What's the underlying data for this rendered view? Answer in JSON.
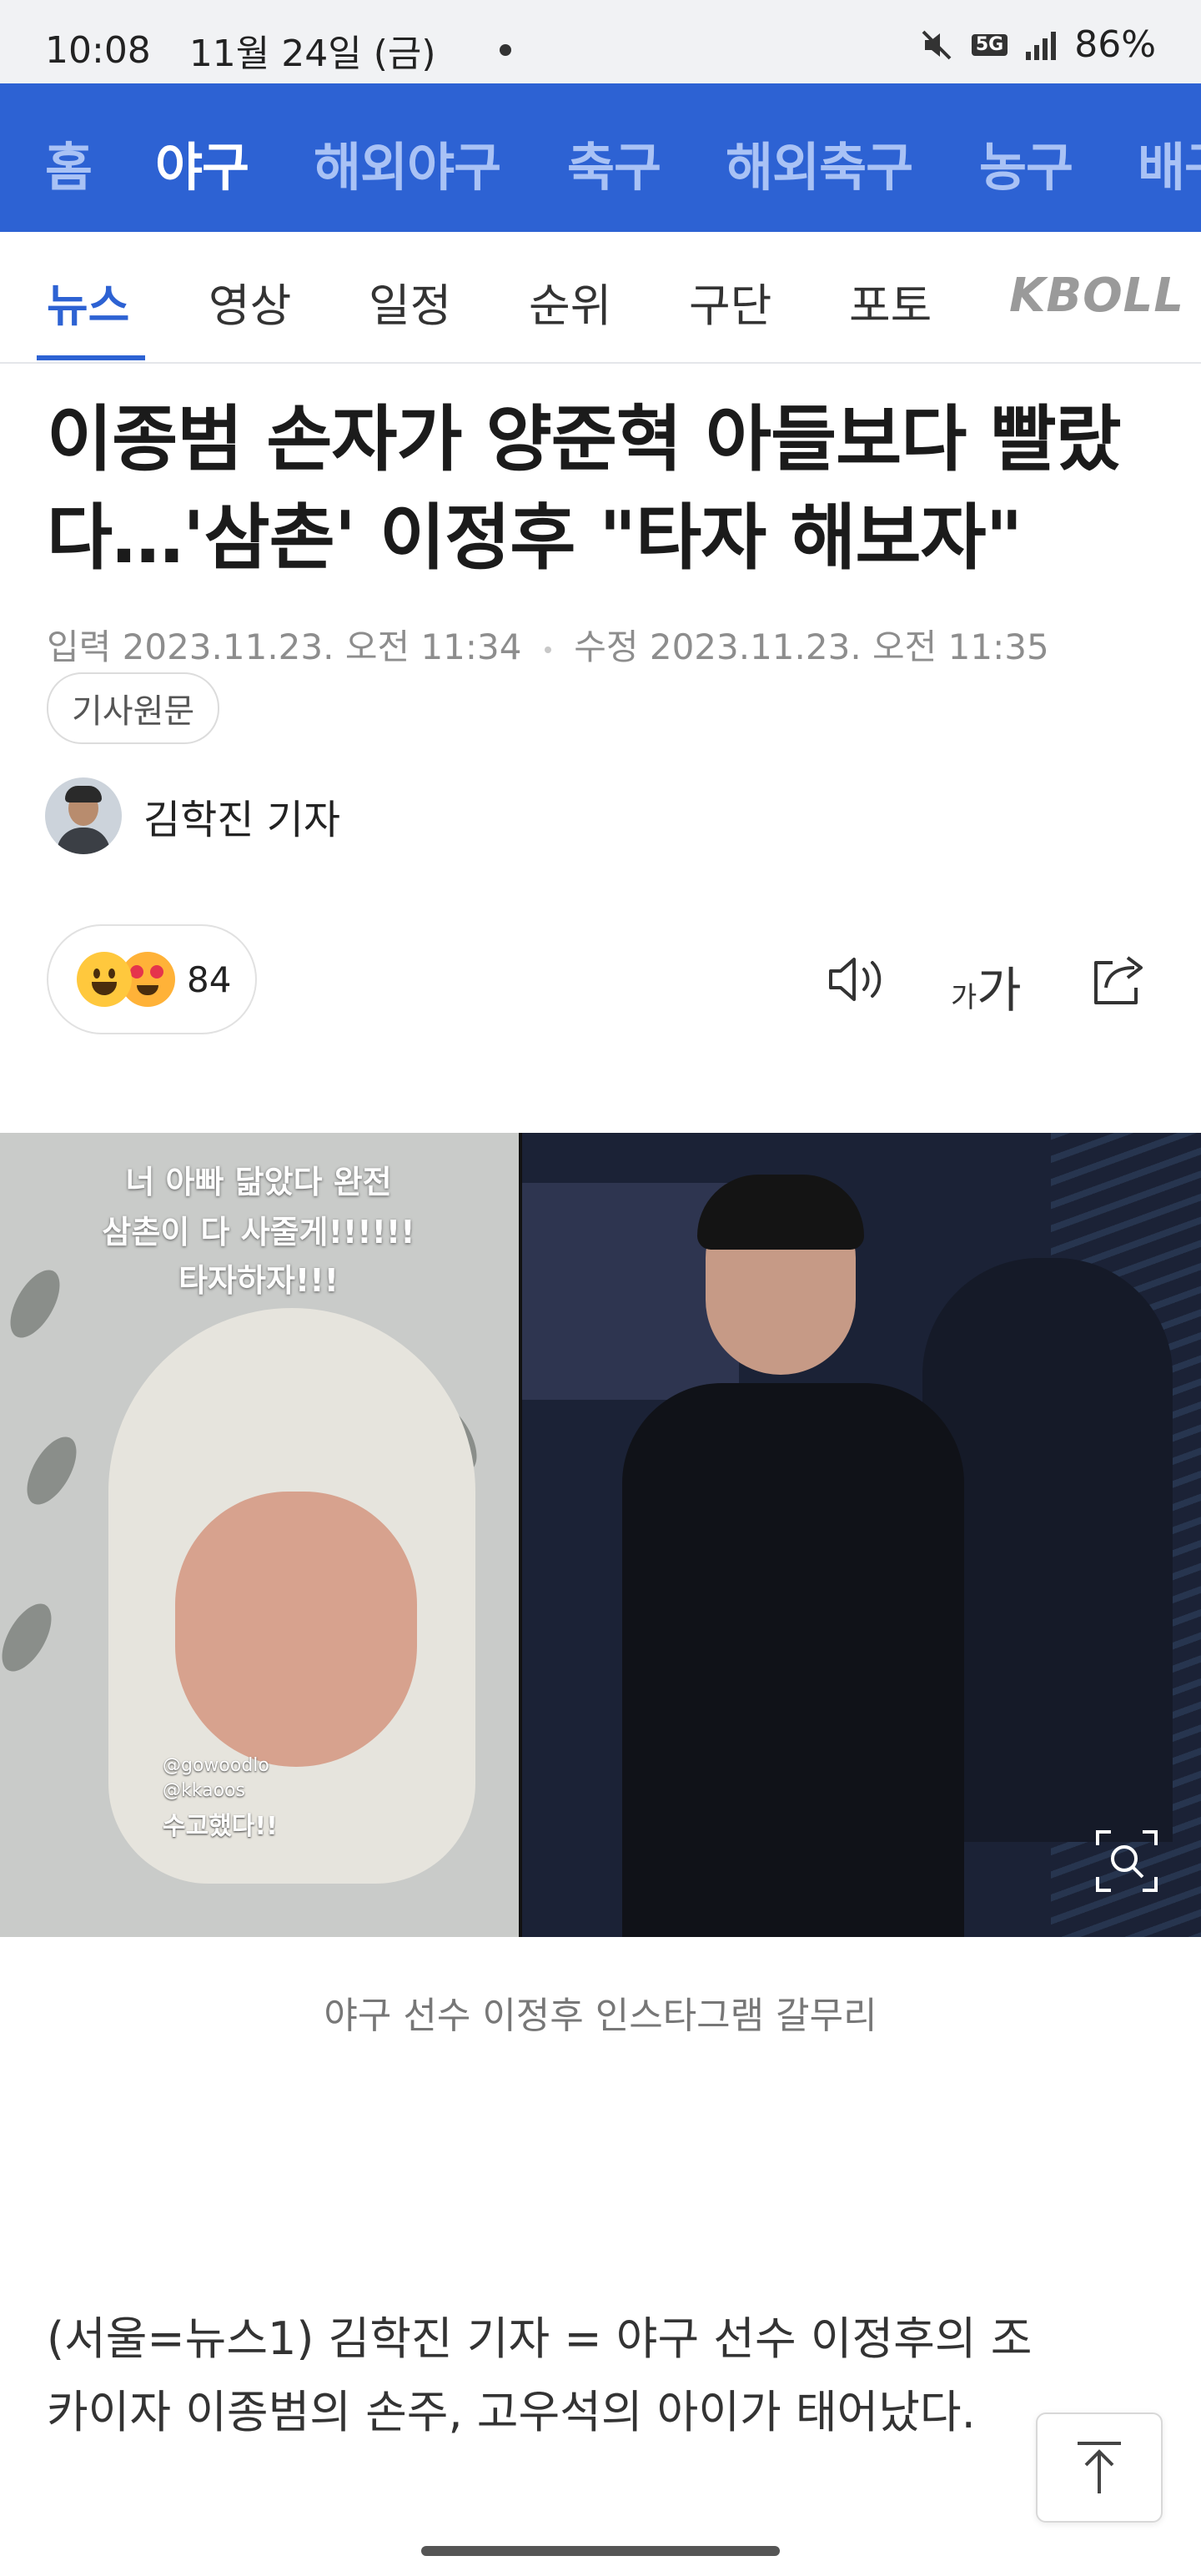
{
  "status_bar": {
    "time": "10:08",
    "date": "11월 24일 (금)",
    "network": "5G",
    "battery": "86%"
  },
  "top_nav": {
    "items": [
      "홈",
      "야구",
      "해외야구",
      "축구",
      "해외축구",
      "농구",
      "배구"
    ],
    "active": "야구"
  },
  "sub_tabs": {
    "items": [
      "뉴스",
      "영상",
      "일정",
      "순위",
      "구단",
      "포토"
    ],
    "active": "뉴스",
    "kbo_label": "KBOLL"
  },
  "article": {
    "headline": "이종범 손자가 양준혁 아들보다 빨랐다…'삼촌' 이정후 \"타자 해보자\"",
    "input_label": "입력",
    "input_date": "2023.11.23. 오전 11:34",
    "edit_label": "수정",
    "edit_date": "2023.11.23. 오전 11:35",
    "original_button": "기사원문",
    "reporter": "김학진 기자",
    "reaction_count": "84",
    "font_tool_small": "가",
    "font_tool_large": "가",
    "photo_text_top": [
      "너 아빠 닮았다 완전",
      "삼촌이 다 사줄게!!!!!!",
      "타자하자!!!"
    ],
    "photo_text_bottom": [
      "@gowoodlo",
      "@kkaoos",
      "수고했다!!"
    ],
    "image_caption": "야구 선수 이정후 인스타그램 갈무리",
    "body_line1": "(서울=뉴스1) 김학진 기자 = 야구 선수 이정후의 조",
    "body_line2": "카이자 이종범의 손주, 고우석의 아이가 태어났다."
  },
  "colors": {
    "brand_blue": "#2d62d3",
    "nav_inactive": "#a9c2f5"
  },
  "icons": [
    "mute-icon",
    "signal-icon",
    "speaker-icon",
    "font-size-icon",
    "share-icon",
    "zoom-icon",
    "arrow-up-icon"
  ]
}
